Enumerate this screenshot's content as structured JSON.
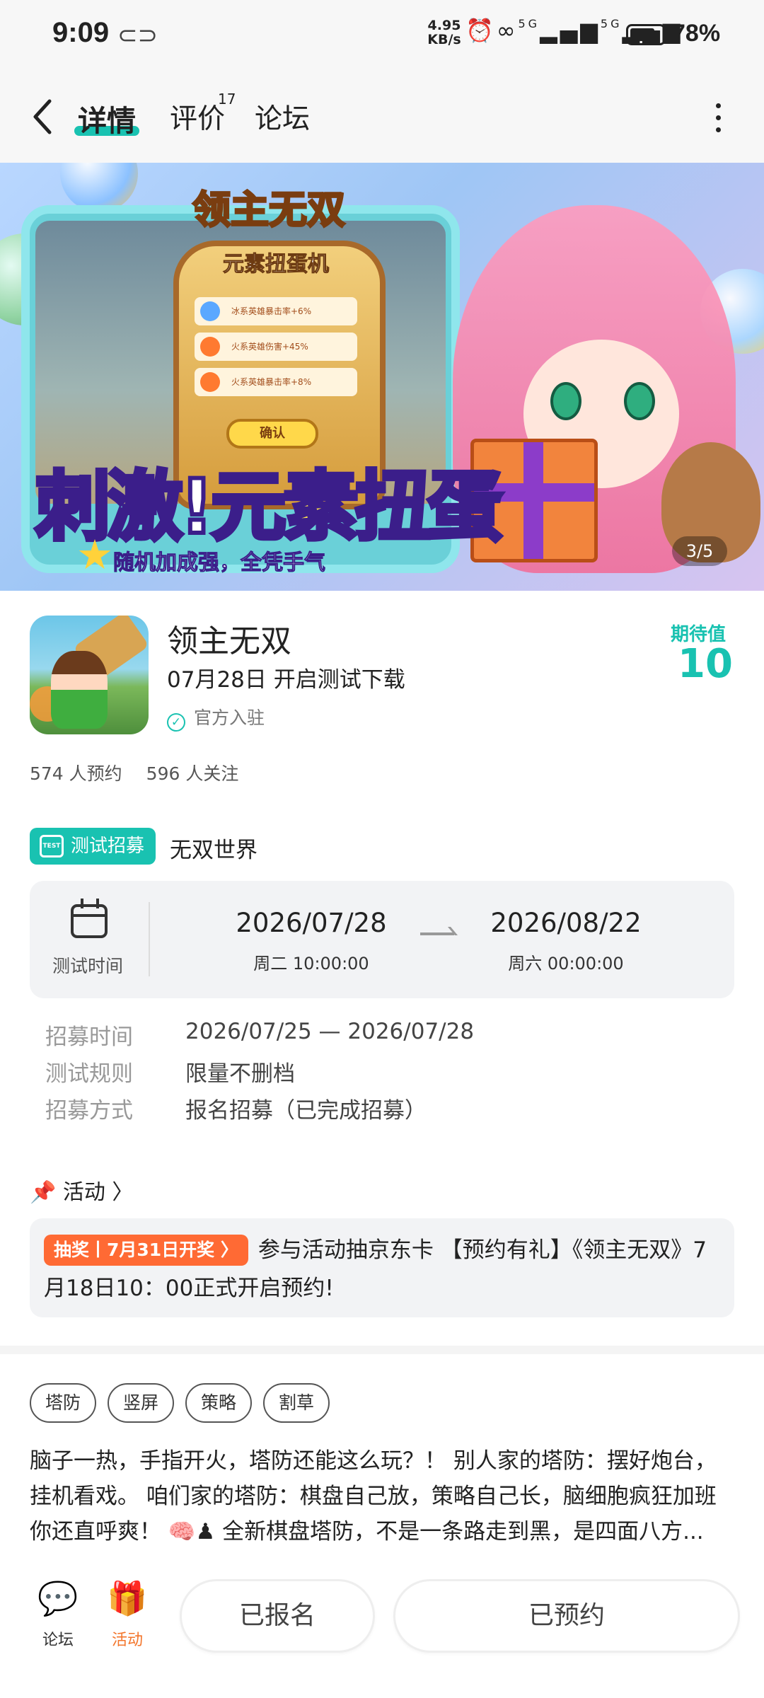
{
  "status_bar": {
    "time": "9:09",
    "speed_top": "4.95",
    "speed_bottom": "KB/s",
    "network_left": "5G",
    "network_right": "5G",
    "battery": "78%",
    "battery_level": 0.78
  },
  "nav": {
    "tabs": [
      "详情",
      "评价",
      "论坛"
    ],
    "review_count": "17",
    "active_tab": "详情"
  },
  "banner": {
    "logo": "领主无双",
    "machine_title": "元素扭蛋机",
    "rows": [
      "冰系英雄暴击率+6%",
      "火系英雄伤害+45%",
      "火系英雄暴击率+8%"
    ],
    "confirm": "确认",
    "headline_a": "刺激!",
    "headline_b": "元素扭蛋",
    "slogan": "随机加成强，全凭手气",
    "counter": "3/5"
  },
  "app": {
    "name": "领主无双",
    "date": "07月28日 开启测试下载",
    "official": "官方入驻",
    "expect_label": "期待值",
    "expect_value": "10"
  },
  "stats": {
    "reservations": "574 人预约",
    "follows": "596 人关注"
  },
  "recruit": {
    "badge": "测试招募",
    "badge_icon": "TEST",
    "title": "无双世界",
    "time_label": "测试时间",
    "start_date": "2026/07/28",
    "start_sub": "周二  10:00:00",
    "end_date": "2026/08/22",
    "end_sub": "周六  00:00:00",
    "details": [
      {
        "k": "招募时间",
        "v": "2026/07/25 — 2026/07/28"
      },
      {
        "k": "测试规则",
        "v": "限量不删档"
      },
      {
        "k": "招募方式",
        "v": "报名招募（已完成招募）"
      }
    ]
  },
  "activity": {
    "header": "活动",
    "lottery_tag": "抽奖丨7月31日开奖 〉",
    "text": "参与活动抽京东卡 【预约有礼】《领主无双》7月18日10：00正式开启预约!"
  },
  "tags": [
    "塔防",
    "竖屏",
    "策略",
    "割草"
  ],
  "description": "脑子一热，手指开火，塔防还能这么玩？！ 别人家的塔防：摆好炮台，挂机看戏。 咱们家的塔防：棋盘自己放，策略自己长，脑细胞疯狂加班你还直呼爽！ 🧠♟ 全新棋盘塔防，不是一条路走到黑，是四面八方...",
  "bottom_bar": {
    "forum": "论坛",
    "activity": "活动",
    "registered": "已报名",
    "reserved": "已预约"
  },
  "colors": {
    "accent": "#19c2b1",
    "lottery": "#ff6a34",
    "activity_orange": "#f3752b"
  }
}
